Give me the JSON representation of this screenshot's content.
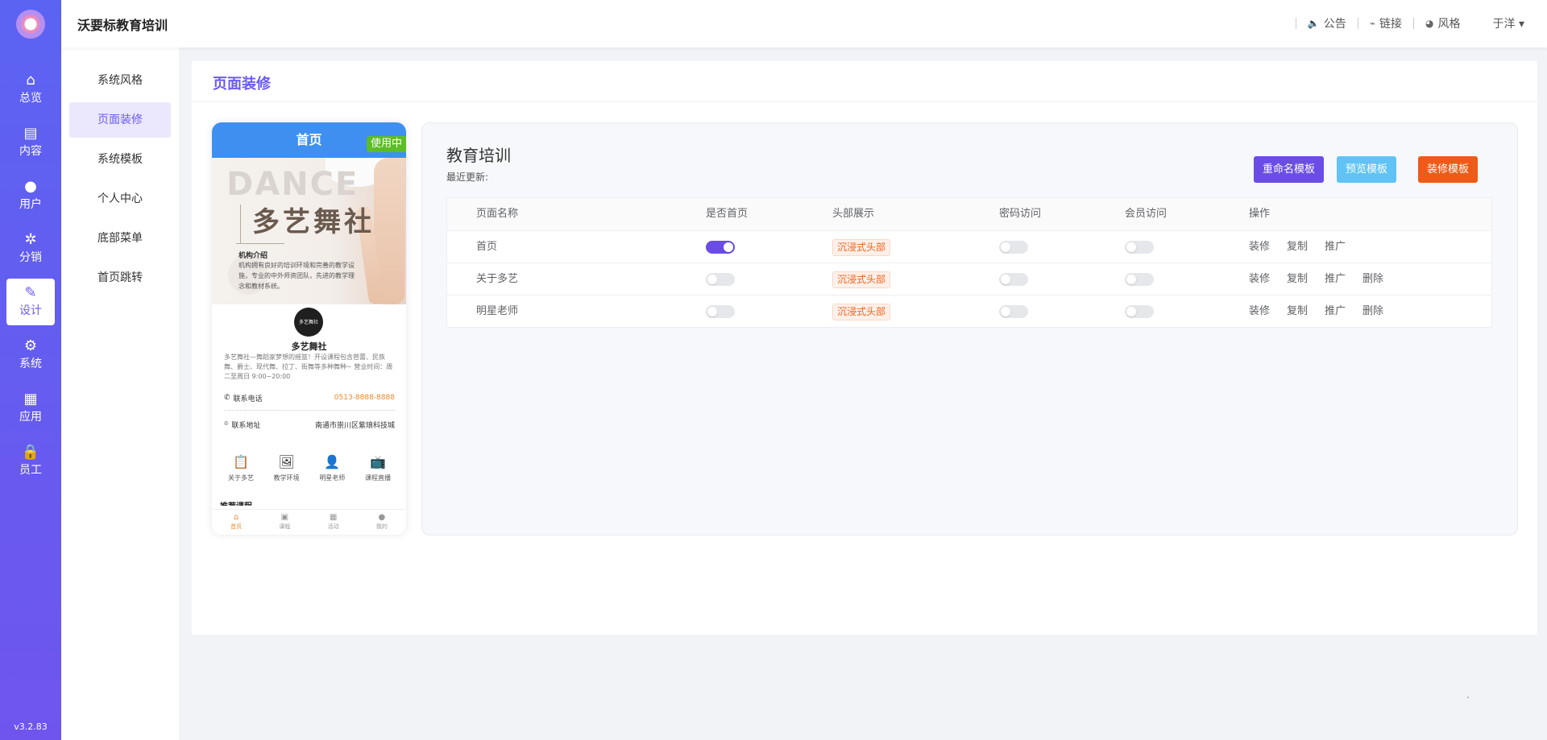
{
  "rail": {
    "version": "v3.2.83",
    "items": [
      {
        "label": "总览",
        "icon": "home-icon",
        "glyph": "⌂"
      },
      {
        "label": "内容",
        "icon": "document-icon",
        "glyph": "▤"
      },
      {
        "label": "用户",
        "icon": "user-icon",
        "glyph": "●"
      },
      {
        "label": "分销",
        "icon": "share-icon",
        "glyph": "✲"
      },
      {
        "label": "设计",
        "icon": "brush-icon",
        "glyph": "✎"
      },
      {
        "label": "系统",
        "icon": "gear-icon",
        "glyph": "⚙"
      },
      {
        "label": "应用",
        "icon": "grid-icon",
        "glyph": "▦"
      },
      {
        "label": "员工",
        "icon": "lock-icon",
        "glyph": "🔒"
      }
    ],
    "active_index": 4
  },
  "submenu": {
    "items": [
      "系统风格",
      "页面装修",
      "系统模板",
      "个人中心",
      "底部菜单",
      "首页跳转"
    ],
    "active_index": 1
  },
  "header": {
    "title": "沃要标教育培训",
    "links": [
      {
        "label": "公告",
        "icon": "speaker-icon",
        "glyph": "🔈"
      },
      {
        "label": "链接",
        "icon": "paperclip-icon",
        "glyph": "⌁"
      },
      {
        "label": "风格",
        "icon": "palette-icon",
        "glyph": "◕"
      }
    ],
    "user": "于洋",
    "user_caret": "▾"
  },
  "main": {
    "page_title": "页面装修"
  },
  "phone": {
    "top_title": "首页",
    "in_use_badge": "使用中",
    "banner": {
      "watermark": "DANCE",
      "name": "多艺舞社",
      "intro_title": "机构介绍",
      "intro_text": "机构拥有良好的培训环境和完善的教学设施，专业的中外师资团队，先进的教学理念和教材系统。"
    },
    "club_logo_text": "多艺舞社",
    "club_name": "多艺舞社",
    "club_desc": "多艺舞社—舞蹈家梦想的摇篮！开设课程包含芭蕾、民族舞、爵士、现代舞、拉丁、街舞等多种舞种~ 营业时间：周二至周日 9:00~20:00",
    "phone_label": "联系电话",
    "phone_value": "0513-8888-8888",
    "address_label": "联系地址",
    "address_value": "南通市崇川区紫琅科技城",
    "quick_nav": [
      {
        "label": "关于多艺",
        "icon": "clipboard-icon",
        "glyph": "📋"
      },
      {
        "label": "教学环境",
        "icon": "image-icon",
        "glyph": "🖼"
      },
      {
        "label": "明星老师",
        "icon": "person-icon",
        "glyph": "👤"
      },
      {
        "label": "课程直播",
        "icon": "tv-icon",
        "glyph": "📺"
      }
    ],
    "recommend_title": "推荐课程",
    "tabbar": [
      {
        "label": "首页",
        "icon": "home-icon",
        "glyph": "⌂"
      },
      {
        "label": "课程",
        "icon": "book-icon",
        "glyph": "▣"
      },
      {
        "label": "活动",
        "icon": "grid-icon",
        "glyph": "▦"
      },
      {
        "label": "我的",
        "icon": "user-icon",
        "glyph": "●"
      }
    ]
  },
  "panel": {
    "title": "教育培训",
    "subtitle": "最近更新:",
    "buttons": {
      "rename": "重命名模板",
      "preview": "预览模板",
      "decorate": "装修模板"
    },
    "colors": {
      "rename": "#6b4de6",
      "preview": "#61c3f5",
      "decorate": "#ee5a17",
      "switch_on": "#6b4de6"
    },
    "table": {
      "columns": [
        "页面名称",
        "是否首页",
        "头部展示",
        "密码访问",
        "会员访问",
        "操作"
      ],
      "rows": [
        {
          "name": "首页",
          "is_home": true,
          "header": "沉浸式头部",
          "password": false,
          "member": false,
          "ops": [
            "装修",
            "复制",
            "推广"
          ]
        },
        {
          "name": "关于多艺",
          "is_home": false,
          "header": "沉浸式头部",
          "password": false,
          "member": false,
          "ops": [
            "装修",
            "复制",
            "推广",
            "删除"
          ]
        },
        {
          "name": "明星老师",
          "is_home": false,
          "header": "沉浸式头部",
          "password": false,
          "member": false,
          "ops": [
            "装修",
            "复制",
            "推广",
            "删除"
          ]
        }
      ]
    }
  }
}
